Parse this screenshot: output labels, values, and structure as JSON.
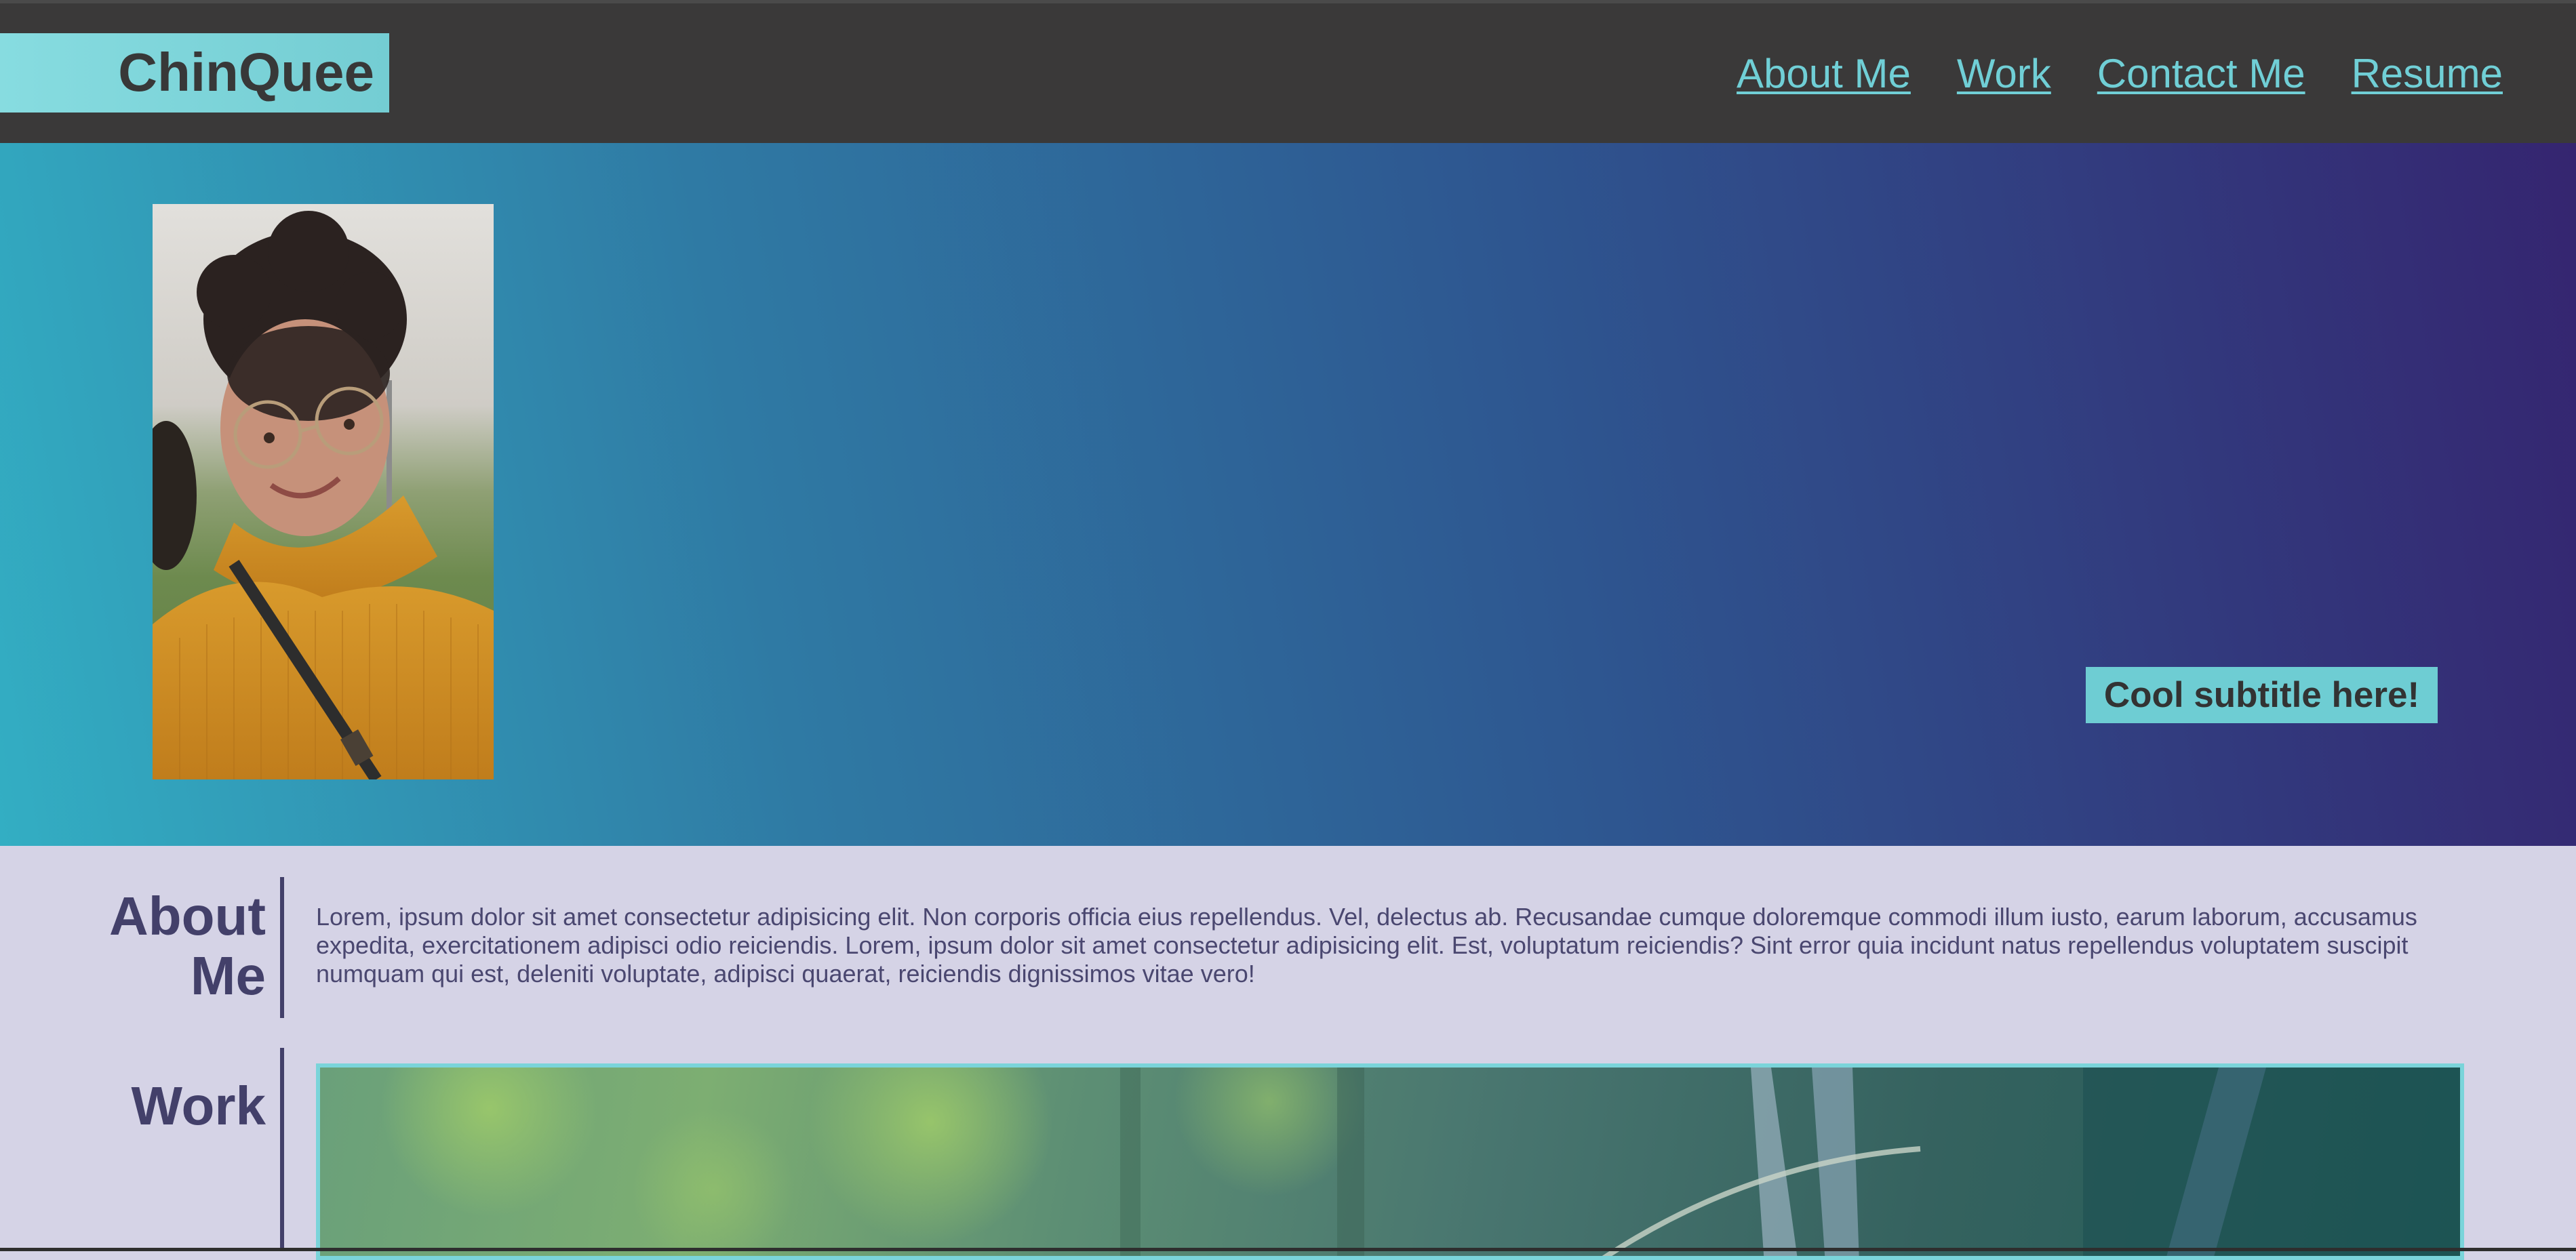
{
  "site": {
    "brand": "ChinQuee"
  },
  "nav": {
    "items": [
      {
        "label": "About Me"
      },
      {
        "label": "Work"
      },
      {
        "label": "Contact Me"
      },
      {
        "label": "Resume"
      }
    ]
  },
  "hero": {
    "subtitle": "Cool subtitle here!"
  },
  "about": {
    "title_line1": "About",
    "title_line2": "Me",
    "body": "Lorem, ipsum dolor sit amet consectetur adipisicing elit. Non corporis officia eius repellendus. Vel, delectus ab. Recusandae cumque doloremque commodi illum iusto, earum laborum, accusamus expedita, exercitationem adipisci odio reiciendis. Lorem, ipsum dolor sit amet consectetur adipisicing elit. Est, voluptatum reiciendis? Sint error quia incidunt natus repellendus voluptatem suscipit numquam qui est, deleniti voluptate, adipisci quaerat, reiciendis dignissimos vitae vero!"
  },
  "work": {
    "title": "Work"
  },
  "colors": {
    "header_bg": "#3a3939",
    "brand_bg": "#7bd4d9",
    "nav_link": "#70cfd6",
    "hero_gradient_start": "#33aec3",
    "hero_gradient_end": "#352570",
    "content_bg": "#d5d3e6",
    "heading": "#43406a",
    "accent": "#6ecdd3"
  }
}
